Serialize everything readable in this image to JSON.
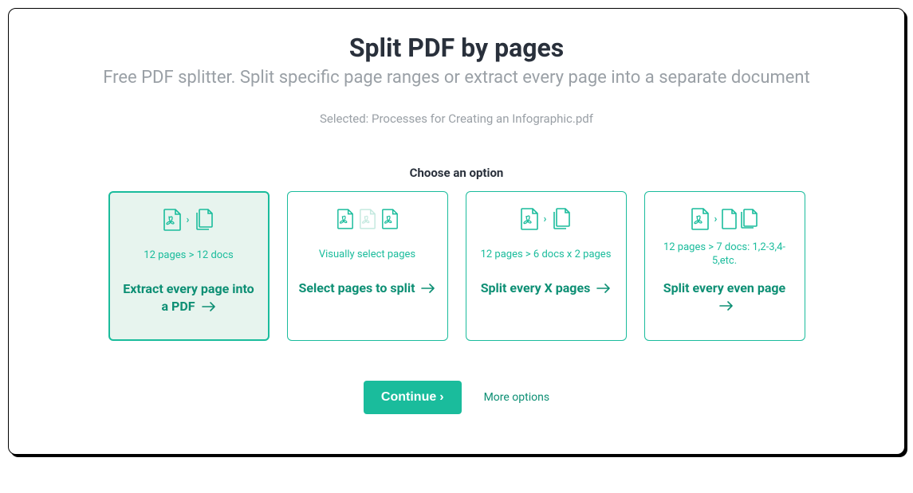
{
  "header": {
    "title": "Split PDF by pages",
    "subtitle": "Free PDF splitter. Split specific page ranges or extract every page into a separate document"
  },
  "selected_prefix": "Selected: ",
  "selected_file": "Processes for Creating an Infographic.pdf",
  "choose_label": "Choose an option",
  "options": [
    {
      "desc": "12 pages > 12 docs",
      "title": "Extract every page into a PDF"
    },
    {
      "desc": "Visually select pages",
      "title": "Select pages to split"
    },
    {
      "desc": "12 pages > 6 docs x 2 pages",
      "title": "Split every X pages"
    },
    {
      "desc": "12 pages > 7 docs: 1,2-3,4-5,etc.",
      "title": "Split every even page"
    }
  ],
  "actions": {
    "continue_label": "Continue",
    "more_options_label": "More options"
  }
}
